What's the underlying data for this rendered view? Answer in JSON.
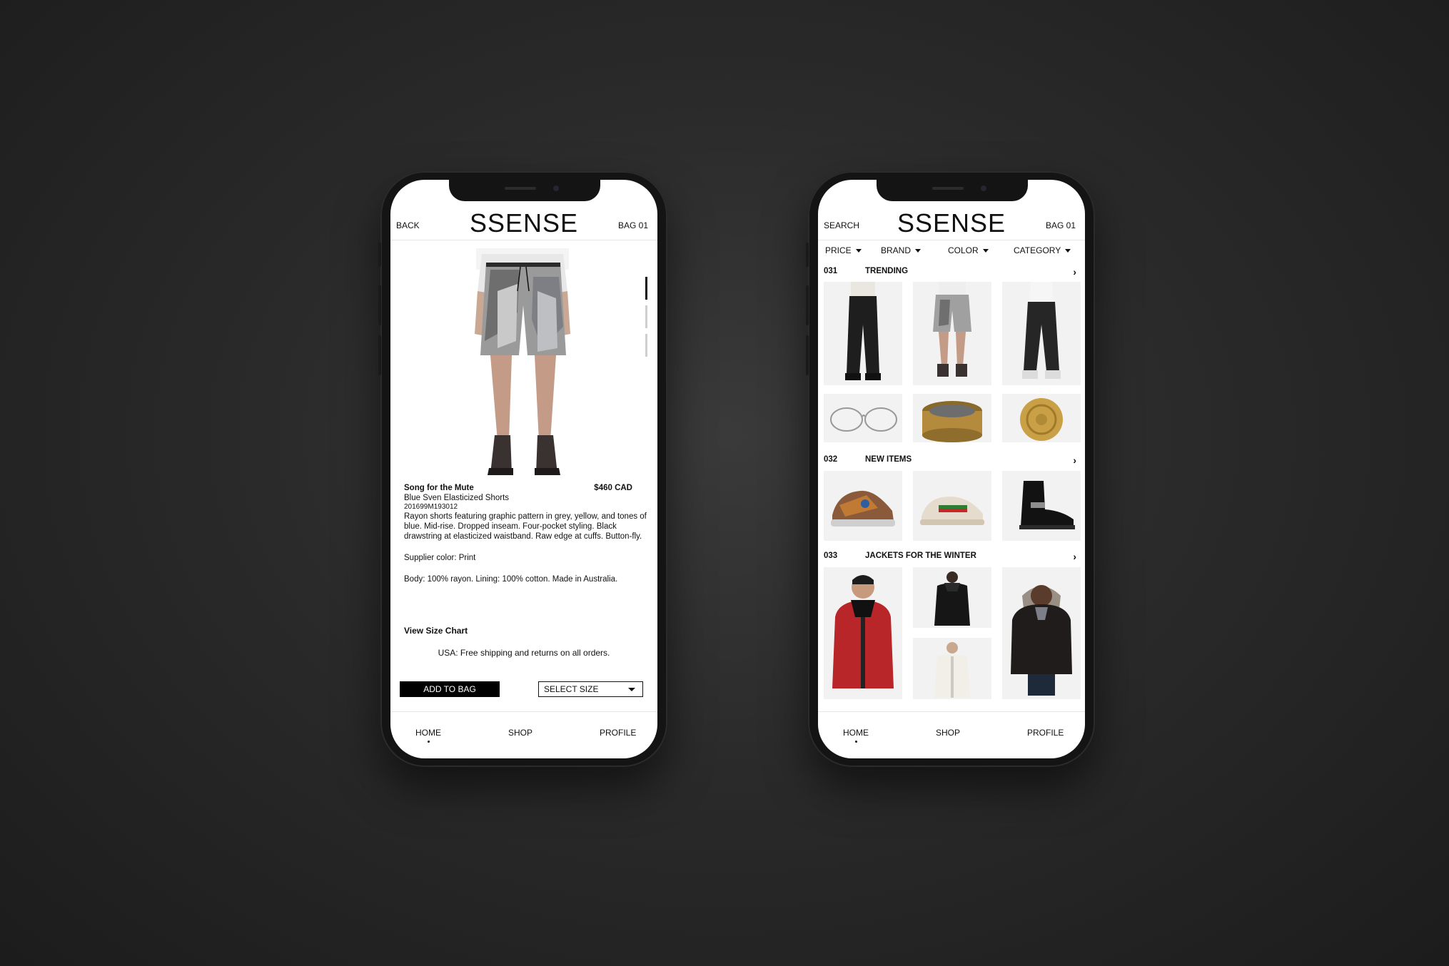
{
  "product_screen": {
    "back_label": "BACK",
    "logo": "SSENSE",
    "bag_label": "BAG 01",
    "product": {
      "brand": "Song for the Mute",
      "price": "$460 CAD",
      "name": "Blue Sven Elasticized Shorts",
      "sku": "201699M193012",
      "description": "Rayon shorts featuring graphic pattern in grey, yellow, and tones of blue. Mid-rise. Dropped inseam. Four-pocket styling. Black drawstring at elasticized waistband. Raw edge at cuffs. Button-fly.",
      "supplier_color": "Supplier color: Print",
      "composition": "Body: 100% rayon. Lining: 100% cotton. Made in Australia."
    },
    "size_chart_label": "View Size Chart",
    "shipping_note": "USA: Free shipping and returns on all orders.",
    "add_to_bag_label": "ADD TO BAG",
    "select_size_label": "SELECT SIZE"
  },
  "shop_screen": {
    "search_label": "SEARCH",
    "logo": "SSENSE",
    "bag_label": "BAG 01",
    "filters": [
      "PRICE",
      "BRAND",
      "COLOR",
      "CATEGORY"
    ],
    "sections": [
      {
        "number": "031",
        "title": "TRENDING"
      },
      {
        "number": "032",
        "title": "NEW ITEMS"
      },
      {
        "number": "033",
        "title": "JACKETS FOR THE WINTER"
      }
    ]
  },
  "tabbar": {
    "home": "HOME",
    "shop": "SHOP",
    "profile": "PROFILE"
  },
  "colors": {
    "background": "#2a2a2a",
    "phone_frame": "#141414",
    "screen": "#ffffff",
    "text": "#111111",
    "tile": "#f2f2f2"
  }
}
